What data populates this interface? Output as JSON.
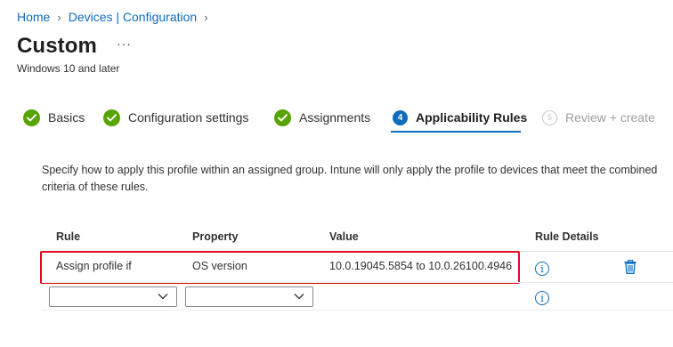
{
  "breadcrumb": [
    {
      "label": "Home"
    },
    {
      "label": "Devices | Configuration"
    }
  ],
  "header": {
    "title": "Custom",
    "more": "···",
    "subtitle": "Windows 10 and later"
  },
  "steps": [
    {
      "label": "Basics",
      "status": "done",
      "icon": "checkmark-icon"
    },
    {
      "label": "Configuration settings",
      "status": "done",
      "icon": "checkmark-icon"
    },
    {
      "label": "Assignments",
      "status": "done",
      "icon": "checkmark-icon"
    },
    {
      "label": "Applicability Rules",
      "status": "current",
      "number": "4"
    },
    {
      "label": "Review + create",
      "status": "future",
      "number": "5"
    }
  ],
  "description": "Specify how to apply this profile within an assigned group. Intune will only apply the profile to devices that meet the combined criteria of these rules.",
  "table": {
    "headers": [
      "Rule",
      "Property",
      "Value",
      "Rule Details"
    ],
    "rows": [
      {
        "rule": "Assign profile if",
        "property": "OS version",
        "value": "10.0.19045.5854 to 10.0.26100.4946"
      }
    ],
    "new_row": {
      "rule_value": "",
      "property_value": ""
    }
  },
  "colors": {
    "accent": "#0f6cbd",
    "success": "#57a300",
    "highlight": "#e00b1c"
  }
}
